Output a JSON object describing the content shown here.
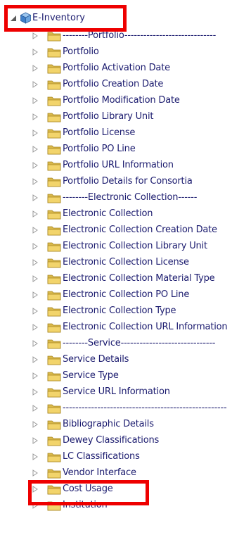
{
  "tree": {
    "root_label": "E-Inventory",
    "root_icon": "cube-icon",
    "items": [
      {
        "label": "--------Portfolio-----------------------------"
      },
      {
        "label": "Portfolio"
      },
      {
        "label": "Portfolio Activation Date"
      },
      {
        "label": "Portfolio Creation Date"
      },
      {
        "label": "Portfolio Modification Date"
      },
      {
        "label": "Portfolio Library Unit"
      },
      {
        "label": "Portfolio License"
      },
      {
        "label": "Portfolio PO Line"
      },
      {
        "label": "Portfolio URL Information"
      },
      {
        "label": "Portfolio Details for Consortia"
      },
      {
        "label": "--------Electronic Collection------"
      },
      {
        "label": "Electronic Collection"
      },
      {
        "label": "Electronic Collection Creation Date"
      },
      {
        "label": "Electronic Collection Library Unit"
      },
      {
        "label": "Electronic Collection License"
      },
      {
        "label": "Electronic Collection Material Type"
      },
      {
        "label": "Electronic Collection PO Line"
      },
      {
        "label": "Electronic Collection Type"
      },
      {
        "label": "Electronic Collection URL Information"
      },
      {
        "label": "--------Service------------------------------"
      },
      {
        "label": "Service Details"
      },
      {
        "label": "Service Type"
      },
      {
        "label": "Service URL Information"
      },
      {
        "label": "----------------------------------------------------"
      },
      {
        "label": "Bibliographic Details"
      },
      {
        "label": "Dewey Classifications"
      },
      {
        "label": "LC Classifications"
      },
      {
        "label": "Vendor Interface"
      },
      {
        "label": "Cost Usage"
      },
      {
        "label": "Institution"
      }
    ]
  },
  "colors": {
    "text": "#1a1a6e",
    "highlight": "#ee0000",
    "folder": "#f2d46b",
    "expander": "#9a9a9a"
  }
}
